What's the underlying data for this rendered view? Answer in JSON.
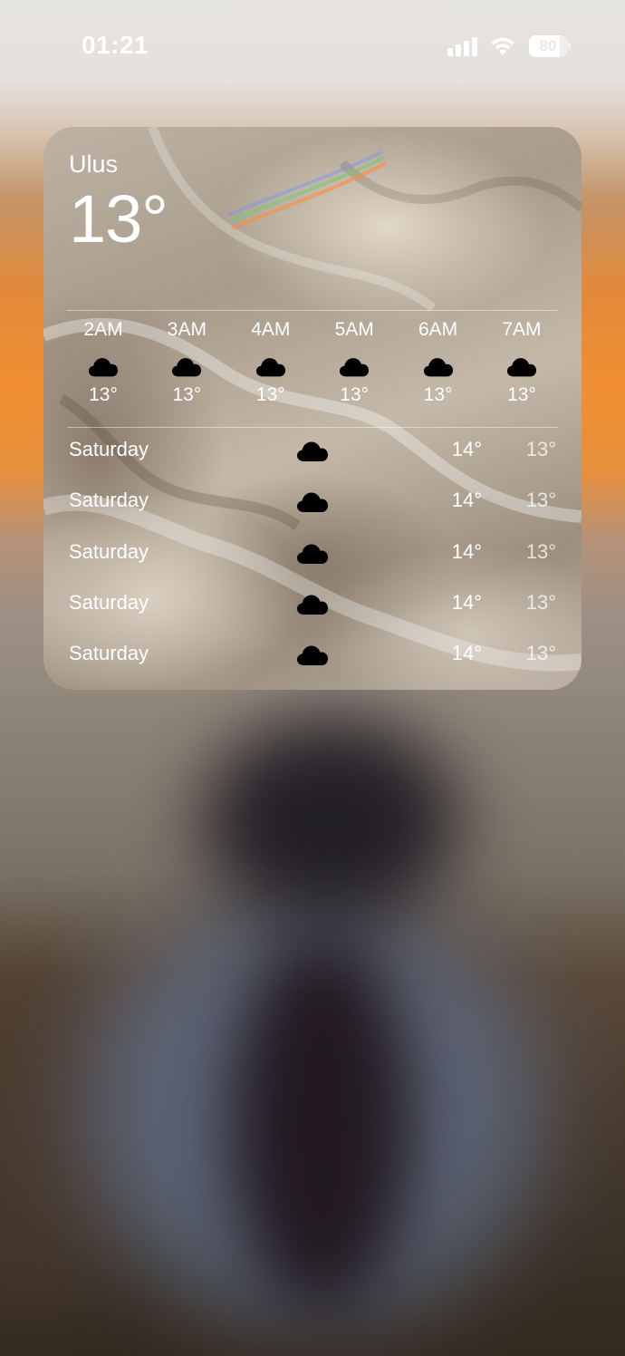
{
  "status_bar": {
    "time": "01:21",
    "battery_level": "80",
    "battery_percent": 80,
    "signal_bars": 4,
    "icons": [
      "signal-icon",
      "wifi-icon",
      "battery-icon"
    ]
  },
  "widget": {
    "location": "Ulus",
    "current_temp": "13°",
    "hourly": [
      {
        "time": "2AM",
        "icon": "cloud-icon",
        "temp": "13°"
      },
      {
        "time": "3AM",
        "icon": "cloud-icon",
        "temp": "13°"
      },
      {
        "time": "4AM",
        "icon": "cloud-icon",
        "temp": "13°"
      },
      {
        "time": "5AM",
        "icon": "cloud-icon",
        "temp": "13°"
      },
      {
        "time": "6AM",
        "icon": "cloud-icon",
        "temp": "13°"
      },
      {
        "time": "7AM",
        "icon": "cloud-icon",
        "temp": "13°"
      }
    ],
    "daily": [
      {
        "day": "Saturday",
        "icon": "cloud-icon",
        "high": "14°",
        "low": "13°"
      },
      {
        "day": "Saturday",
        "icon": "cloud-icon",
        "high": "14°",
        "low": "13°"
      },
      {
        "day": "Saturday",
        "icon": "cloud-icon",
        "high": "14°",
        "low": "13°"
      },
      {
        "day": "Saturday",
        "icon": "cloud-icon",
        "high": "14°",
        "low": "13°"
      },
      {
        "day": "Saturday",
        "icon": "cloud-icon",
        "high": "14°",
        "low": "13°"
      }
    ]
  },
  "colors": {
    "text": "#ffffff",
    "icon": "#000000",
    "wallpaper_accent": "#f08e30"
  }
}
